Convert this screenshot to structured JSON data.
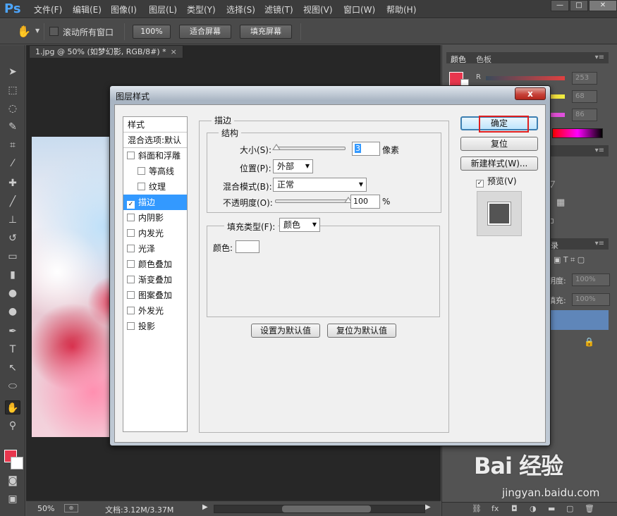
{
  "menubar": {
    "logo": "Ps",
    "items": [
      "文件(F)",
      "编辑(E)",
      "图像(I)",
      "图层(L)",
      "类型(Y)",
      "选择(S)",
      "滤镜(T)",
      "视图(V)",
      "窗口(W)",
      "帮助(H)"
    ]
  },
  "optionsbar": {
    "scroll_all": "滚动所有窗口",
    "zoom_btn": "100%",
    "fit_btn": "适合屏幕",
    "fill_btn": "填充屏幕"
  },
  "document": {
    "tab_title": "1.jpg @ 50% (如梦幻影, RGB/8#) *",
    "tab_close": "×"
  },
  "statusbar": {
    "zoom": "50%",
    "doc_info": "文档:3.12M/3.37M"
  },
  "panels": {
    "color_tab": "颜色",
    "swatches_tab": "色板",
    "r_label": "R",
    "r_value": "253",
    "g_value": "68",
    "b_value": "86",
    "layers_tab_fragment": "录",
    "opacity_label": "明度:",
    "opacity_value": "100%",
    "fill_label": "填充:",
    "fill_value": "100%"
  },
  "dialog": {
    "title": "图层样式",
    "close_label": "x",
    "styles_header": "样式",
    "blend_options": "混合选项:默认",
    "items": [
      {
        "label": "斜面和浮雕",
        "checked": false,
        "indent": false
      },
      {
        "label": "等高线",
        "checked": false,
        "indent": true
      },
      {
        "label": "纹理",
        "checked": false,
        "indent": true
      },
      {
        "label": "描边",
        "checked": true,
        "indent": false,
        "selected": true
      },
      {
        "label": "内阴影",
        "checked": false,
        "indent": false
      },
      {
        "label": "内发光",
        "checked": false,
        "indent": false
      },
      {
        "label": "光泽",
        "checked": false,
        "indent": false
      },
      {
        "label": "颜色叠加",
        "checked": false,
        "indent": false
      },
      {
        "label": "渐变叠加",
        "checked": false,
        "indent": false
      },
      {
        "label": "图案叠加",
        "checked": false,
        "indent": false
      },
      {
        "label": "外发光",
        "checked": false,
        "indent": false
      },
      {
        "label": "投影",
        "checked": false,
        "indent": false
      }
    ],
    "stroke": {
      "section": "描边",
      "structure": "结构",
      "size_label": "大小(S):",
      "size_value": "3",
      "size_unit": "像素",
      "position_label": "位置(P):",
      "position_value": "外部",
      "blend_label": "混合模式(B):",
      "blend_value": "正常",
      "opacity_label": "不透明度(O):",
      "opacity_value": "100",
      "opacity_unit": "%",
      "opacity_fraction": 1.0,
      "size_fraction": 0.0,
      "fill_type_label": "填充类型(F):",
      "fill_type_value": "颜色",
      "color_label": "颜色:",
      "color": "#fdfdfd",
      "set_default": "设置为默认值",
      "reset_default": "复位为默认值"
    },
    "buttons": {
      "ok": "确定",
      "reset": "复位",
      "new_style": "新建样式(W)...",
      "preview": "预览(V)",
      "preview_checked": true
    }
  },
  "watermark": {
    "logo": "Bai 经验",
    "url": "jingyan.baidu.com"
  },
  "colors": {
    "foreground": "#e8364d",
    "background": "#ffffff",
    "selection": "#3399ff",
    "highlight_box": "#e02020"
  }
}
